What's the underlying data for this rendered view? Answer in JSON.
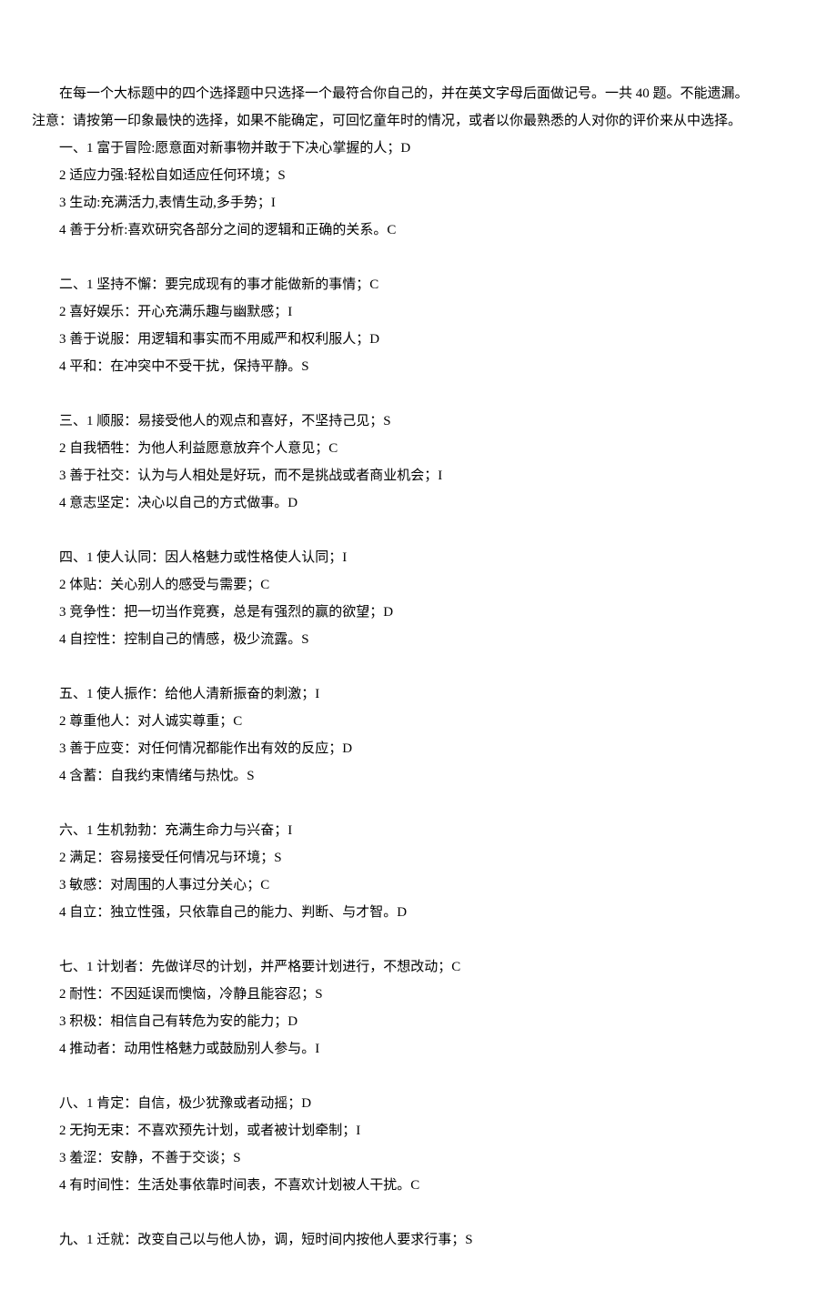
{
  "intro_line1": "在每一个大标题中的四个选择题中只选择一个最符合你自己的，并在英文字母后面做记号。一共 40 题。不能遗漏。",
  "intro_line2": "注意：请按第一印象最快的选择，如果不能确定，可回忆童年时的情况，或者以你最熟悉的人对你的评价来从中选择。",
  "groups": [
    {
      "first": "一、1 富于冒险:愿意面对新事物并敢于下决心掌握的人；D",
      "rest": [
        "2 适应力强:轻松自如适应任何环境；S",
        "3 生动:充满活力,表情生动,多手势；I",
        "4 善于分析:喜欢研究各部分之间的逻辑和正确的关系。C"
      ]
    },
    {
      "first": "二、1 坚持不懈：要完成现有的事才能做新的事情；C",
      "rest": [
        "2 喜好娱乐：开心充满乐趣与幽默感；I",
        "3 善于说服：用逻辑和事实而不用威严和权利服人；D",
        "4 平和：在冲突中不受干扰，保持平静。S"
      ]
    },
    {
      "first": "三、1 顺服：易接受他人的观点和喜好，不坚持己见；S",
      "rest": [
        "2 自我牺牲：为他人利益愿意放弃个人意见；C",
        "3 善于社交：认为与人相处是好玩，而不是挑战或者商业机会；I",
        "4 意志坚定：决心以自己的方式做事。D"
      ]
    },
    {
      "first": "四、1 使人认同：因人格魅力或性格使人认同；I",
      "rest": [
        "2 体贴：关心别人的感受与需要；C",
        "3 竞争性：把一切当作竞赛，总是有强烈的赢的欲望；D",
        "4 自控性：控制自己的情感，极少流露。S"
      ]
    },
    {
      "first": "五、1 使人振作：给他人清新振奋的刺激；I",
      "rest": [
        "2 尊重他人：对人诚实尊重；C",
        "3 善于应变：对任何情况都能作出有效的反应；D",
        "4 含蓄：自我约束情绪与热忱。S"
      ]
    },
    {
      "first": "六、1 生机勃勃：充满生命力与兴奋；I",
      "rest": [
        "2 满足：容易接受任何情况与环境；S",
        "3 敏感：对周围的人事过分关心；C",
        "4 自立：独立性强，只依靠自己的能力、判断、与才智。D"
      ]
    },
    {
      "first": "七、1 计划者：先做详尽的计划，并严格要计划进行，不想改动；C",
      "rest": [
        "2 耐性：不因延误而懊恼，冷静且能容忍；S",
        "3 积极：相信自己有转危为安的能力；D",
        "4 推动者：动用性格魅力或鼓励别人参与。I"
      ]
    },
    {
      "first": "八、1 肯定：自信，极少犹豫或者动摇；D",
      "rest": [
        "2 无拘无束：不喜欢预先计划，或者被计划牵制；I",
        "3 羞涩：安静，不善于交谈；S",
        "4 有时间性：生活处事依靠时间表，不喜欢计划被人干扰。C"
      ]
    },
    {
      "first": "九、1 迁就：改变自己以与他人协，调，短时间内按他人要求行事；S",
      "rest": []
    }
  ]
}
